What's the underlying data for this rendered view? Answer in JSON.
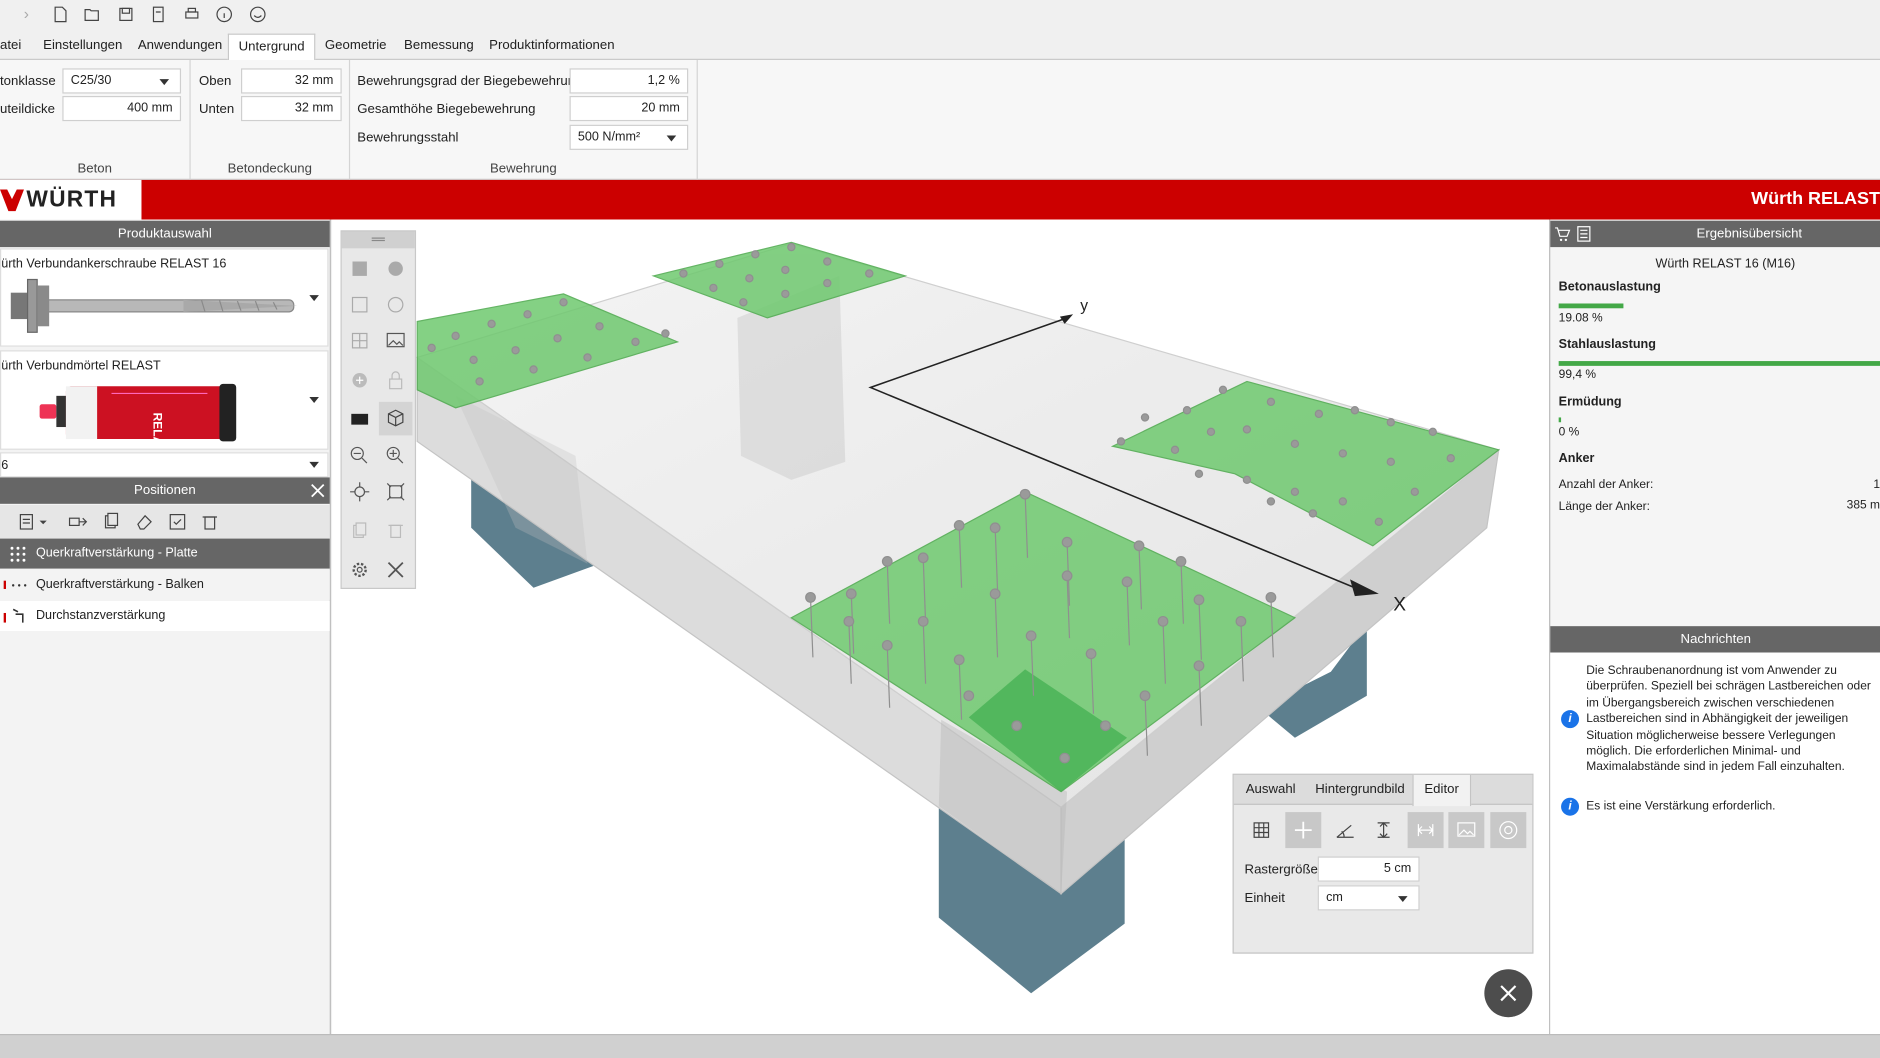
{
  "menu": {
    "tabs": [
      "atei",
      "Einstellungen",
      "Anwendungen",
      "Untergrund",
      "Geometrie",
      "Bemessung",
      "Produktinformationen"
    ],
    "active_tab": "Untergrund"
  },
  "ribbon": {
    "beton": {
      "label": "Beton",
      "betonklasse_label": "tonklasse",
      "betonklasse_value": "C25/30",
      "bauteildicke_label": "uteildicke",
      "bauteildicke_value": "400 mm"
    },
    "betondeckung": {
      "label": "Betondeckung",
      "oben_label": "Oben",
      "oben_value": "32 mm",
      "unten_label": "Unten",
      "unten_value": "32 mm"
    },
    "bewehrung": {
      "label": "Bewehrung",
      "grad_label": "Bewehrungsgrad der Biegebewehrung",
      "grad_value": "1,2 %",
      "hoehe_label": "Gesamthöhe Biegebewehrung",
      "hoehe_value": "20 mm",
      "stahl_label": "Bewehrungsstahl",
      "stahl_value": "500 N/mm²"
    }
  },
  "brand": {
    "logo_text": "WÜRTH",
    "title": "Würth RELAST"
  },
  "left_panel": {
    "produktauswahl_title": "Produktauswahl",
    "product1_name": "ürth Verbundankerschraube RELAST 16",
    "product2_name": "ürth Verbundmörtel RELAST",
    "size_value": "6",
    "positionen_title": "Positionen",
    "positions": [
      {
        "label": "Querkraftverstärkung - Platte",
        "selected": true
      },
      {
        "label": "Querkraftverstärkung - Balken",
        "selected": false
      },
      {
        "label": "Durchstanzverstärkung",
        "selected": false
      }
    ]
  },
  "viewport": {
    "axis_y": "y",
    "axis_x": "X"
  },
  "editor": {
    "tabs": [
      "Auswahl",
      "Hintergrundbild",
      "Editor"
    ],
    "active_tab": "Editor",
    "rastergroesse_label": "Rastergröße",
    "rastergroesse_value": "5 cm",
    "einheit_label": "Einheit",
    "einheit_value": "cm"
  },
  "right_panel": {
    "title": "Ergebnisübersicht",
    "product": "Würth RELAST 16 (M16)",
    "betonauslastung_label": "Betonauslastung",
    "betonauslastung_value": "19.08 %",
    "betonauslastung_fraction": 0.1908,
    "stahlauslastung_label": "Stahlauslastung",
    "stahlauslastung_value": "99,4 %",
    "stahlauslastung_fraction": 0.994,
    "ermuedung_label": "Ermüdung",
    "ermuedung_value": "0 %",
    "ermuedung_fraction": 0.0,
    "anker_label": "Anker",
    "anzahl_label": "Anzahl der Anker:",
    "anzahl_value": "1",
    "laenge_label": "Länge der Anker:",
    "laenge_value": "385 m",
    "nachrichten_title": "Nachrichten",
    "message1": "Die Schraubenanordnung ist vom Anwender zu überprüfen. Speziell bei schrägen Lastbereichen oder im Übergangsbereich zwischen verschiedenen Lastbereichen sind in Abhängigkeit der jeweiligen Situation möglicherweise bessere Verlegungen möglich. Die erforderlichen Minimal- und Maximalabstände sind in jedem Fall einzuhalten.",
    "message2": "Es ist eine Verstärkung erforderlich."
  },
  "colors": {
    "brand_red": "#cc0000",
    "bar_green": "#43a847",
    "zone_green": "#6fc96f",
    "column_blue": "#5d7f8e",
    "info_blue": "#1a73e8"
  }
}
